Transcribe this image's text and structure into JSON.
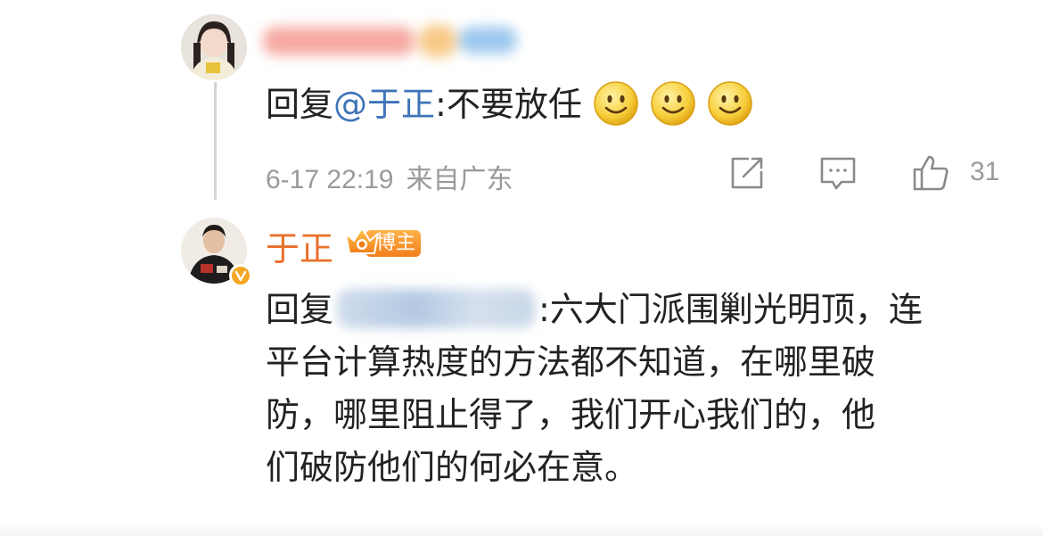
{
  "thread": {
    "first_comment": {
      "reply_prefix": "回复",
      "mention": "@于正",
      "text": ":不要放任",
      "emojis": [
        "smile-emoji",
        "smile-emoji",
        "smile-emoji"
      ],
      "date": "6-17 22:19",
      "location": "来自广东",
      "like_count": "31"
    },
    "author_reply": {
      "author_name": "于正",
      "badge_label": "博主",
      "reply_prefix": "回复",
      "text_lines": [
        ":六大门派围剿光明顶，连",
        "平台计算热度的方法都不知道，在哪里破",
        "防，哪里阻止得了，我们开心我们的，他",
        "们破防他们的何必在意。"
      ]
    }
  },
  "colors": {
    "mention": "#3f74b8",
    "author_name": "#e8702a",
    "meta_text": "#9a9a9a",
    "badge": "#f27f1b"
  }
}
